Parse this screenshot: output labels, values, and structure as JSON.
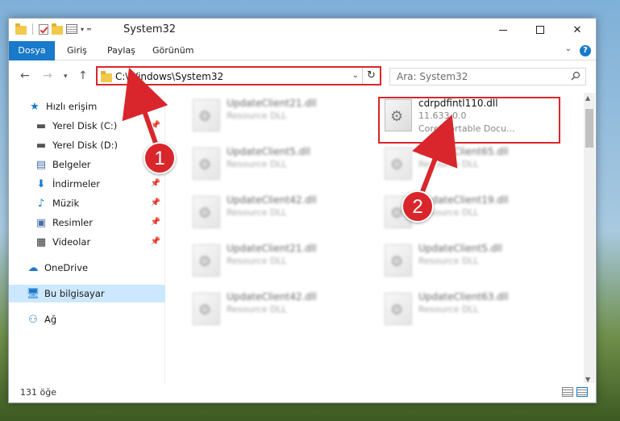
{
  "window": {
    "title": "System32"
  },
  "ribbon": {
    "tabs": [
      {
        "label": "Dosya"
      },
      {
        "label": "Giriş"
      },
      {
        "label": "Paylaş"
      },
      {
        "label": "Görünüm"
      }
    ],
    "help": "?"
  },
  "nav": {
    "address": "C:\\Windows\\System32",
    "search_placeholder": "Ara: System32"
  },
  "sidebar": {
    "items": [
      {
        "label": "Hızlı erişim",
        "icon": "star-icon"
      },
      {
        "label": "Yerel Disk (C:)",
        "icon": "drive-icon"
      },
      {
        "label": "Yerel Disk (D:)",
        "icon": "drive-icon"
      },
      {
        "label": "Belgeler",
        "icon": "document-icon"
      },
      {
        "label": "İndirmeler",
        "icon": "download-icon"
      },
      {
        "label": "Müzik",
        "icon": "music-icon"
      },
      {
        "label": "Resimler",
        "icon": "pictures-icon"
      },
      {
        "label": "Videolar",
        "icon": "video-icon"
      },
      {
        "label": "OneDrive",
        "icon": "cloud-icon"
      },
      {
        "label": "Bu bilgisayar",
        "icon": "computer-icon"
      },
      {
        "label": "Ağ",
        "icon": "network-icon"
      }
    ]
  },
  "files": {
    "highlighted": {
      "name": "cdrpdfintl110.dll",
      "version": "11.633.0.0",
      "description": "Corel Portable Docu..."
    },
    "left_column": [
      {
        "name": "UpdateClient21.dll",
        "type": "Resource DLL"
      },
      {
        "name": "UpdateClient5.dll",
        "type": "Resource DLL"
      },
      {
        "name": "UpdateClient42.dll",
        "type": "Resource DLL"
      },
      {
        "name": "UpdateClient21.dll",
        "type": "Resource DLL"
      },
      {
        "name": "UpdateClient42.dll",
        "type": "Resource DLL"
      }
    ],
    "right_column": [
      {
        "name": "UpdateClient65.dll",
        "type": "Resource DLL"
      },
      {
        "name": "UpdateClient19.dll",
        "type": "Resource DLL"
      },
      {
        "name": "UpdateClient5.dll",
        "type": "Resource DLL"
      },
      {
        "name": "UpdateClient63.dll",
        "type": "Resource DLL"
      }
    ]
  },
  "status": {
    "count": "131 öğe"
  },
  "annotations": {
    "one": "1",
    "two": "2"
  },
  "colors": {
    "accent": "#1979ca",
    "annotation_red": "#d9262c",
    "selected_bg": "#cce8ff"
  }
}
